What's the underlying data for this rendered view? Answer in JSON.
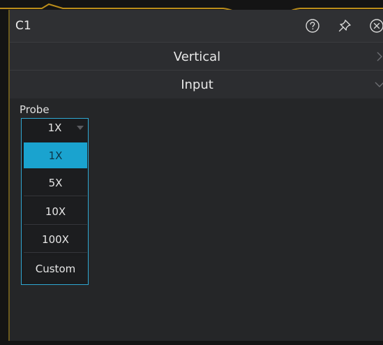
{
  "panel": {
    "title": "C1",
    "title_icons": [
      "help-circle-icon",
      "pin-icon",
      "close-circle-icon"
    ],
    "sections": [
      {
        "label": "Vertical",
        "state": "collapsed"
      },
      {
        "label": "Input",
        "state": "expanded"
      }
    ]
  },
  "probe": {
    "label": "Probe",
    "selected": "1X",
    "options": [
      "1X",
      "5X",
      "10X",
      "100X",
      "Custom"
    ],
    "highlighted_option": "1X"
  },
  "colors": {
    "accent": "#1aa3cf",
    "border_accent": "#2fa8d3",
    "panel_bg": "#252628",
    "trace": "#d8a21b"
  }
}
